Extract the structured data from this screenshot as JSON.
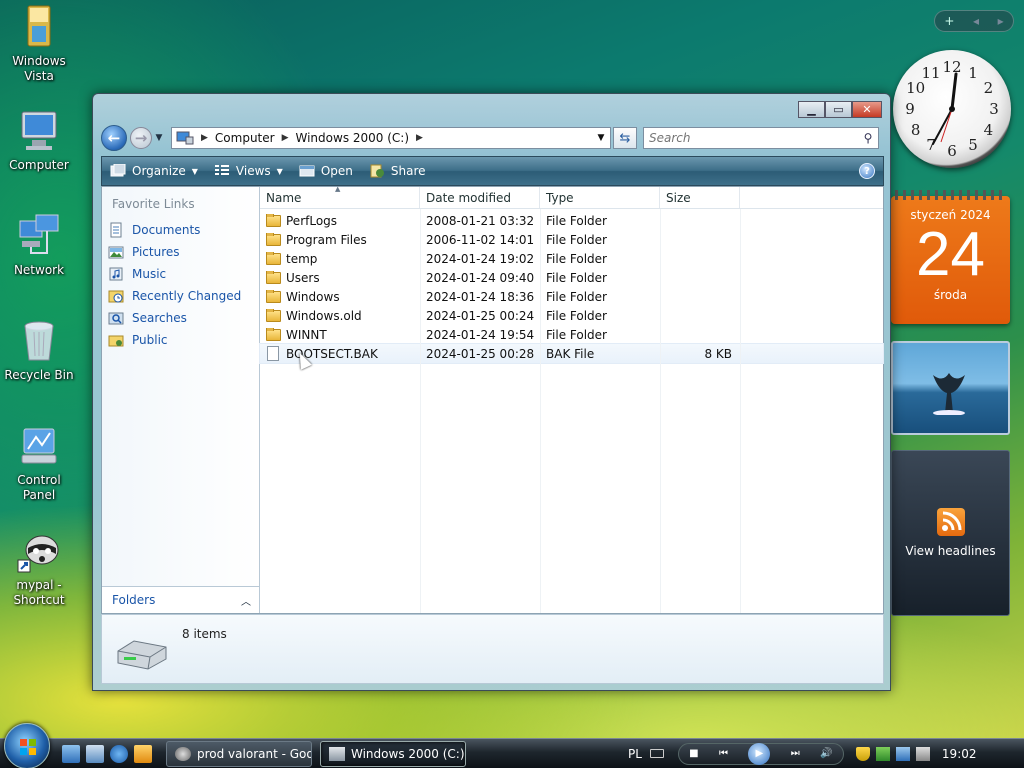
{
  "desktop": {
    "icons": [
      {
        "label": "Windows Vista"
      },
      {
        "label": "Computer"
      },
      {
        "label": "Network"
      },
      {
        "label": "Recycle Bin"
      },
      {
        "label": "Control Panel"
      },
      {
        "label": "mypal - Shortcut"
      }
    ]
  },
  "gadgets": {
    "calendar": {
      "month_year": "styczeń 2024",
      "day": "24",
      "weekday": "środa"
    },
    "feeds": {
      "label": "View headlines"
    },
    "clock": {
      "numbers": [
        "12",
        "1",
        "2",
        "3",
        "4",
        "5",
        "6",
        "7",
        "8",
        "9",
        "10",
        "11"
      ]
    }
  },
  "explorer": {
    "address": {
      "segments": [
        "Computer",
        "Windows 2000 (C:)"
      ]
    },
    "search": {
      "placeholder": "Search"
    },
    "toolbar": {
      "organize": "Organize",
      "views": "Views",
      "open": "Open",
      "share": "Share"
    },
    "nav_pane": {
      "header": "Favorite Links",
      "links": [
        "Documents",
        "Pictures",
        "Music",
        "Recently Changed",
        "Searches",
        "Public"
      ],
      "folders_label": "Folders"
    },
    "columns": {
      "name": "Name",
      "date": "Date modified",
      "type": "Type",
      "size": "Size"
    },
    "files": [
      {
        "name": "PerfLogs",
        "date": "2008-01-21 03:32",
        "type": "File Folder",
        "size": "",
        "kind": "folder"
      },
      {
        "name": "Program Files",
        "date": "2006-11-02 14:01",
        "type": "File Folder",
        "size": "",
        "kind": "folder"
      },
      {
        "name": "temp",
        "date": "2024-01-24 19:02",
        "type": "File Folder",
        "size": "",
        "kind": "folder"
      },
      {
        "name": "Users",
        "date": "2024-01-24 09:40",
        "type": "File Folder",
        "size": "",
        "kind": "folder"
      },
      {
        "name": "Windows",
        "date": "2024-01-24 18:36",
        "type": "File Folder",
        "size": "",
        "kind": "folder"
      },
      {
        "name": "Windows.old",
        "date": "2024-01-25 00:24",
        "type": "File Folder",
        "size": "",
        "kind": "folder"
      },
      {
        "name": "WINNT",
        "date": "2024-01-24 19:54",
        "type": "File Folder",
        "size": "",
        "kind": "folder"
      },
      {
        "name": "BOOTSECT.BAK",
        "date": "2024-01-25 00:28",
        "type": "BAK File",
        "size": "8 KB",
        "kind": "file"
      }
    ],
    "details": {
      "item_count": "8 items"
    }
  },
  "taskbar": {
    "tasks": [
      {
        "label": "prod valorant - Goo..."
      },
      {
        "label": "Windows 2000 (C:)"
      }
    ],
    "language": "PL",
    "time": "19:02"
  }
}
